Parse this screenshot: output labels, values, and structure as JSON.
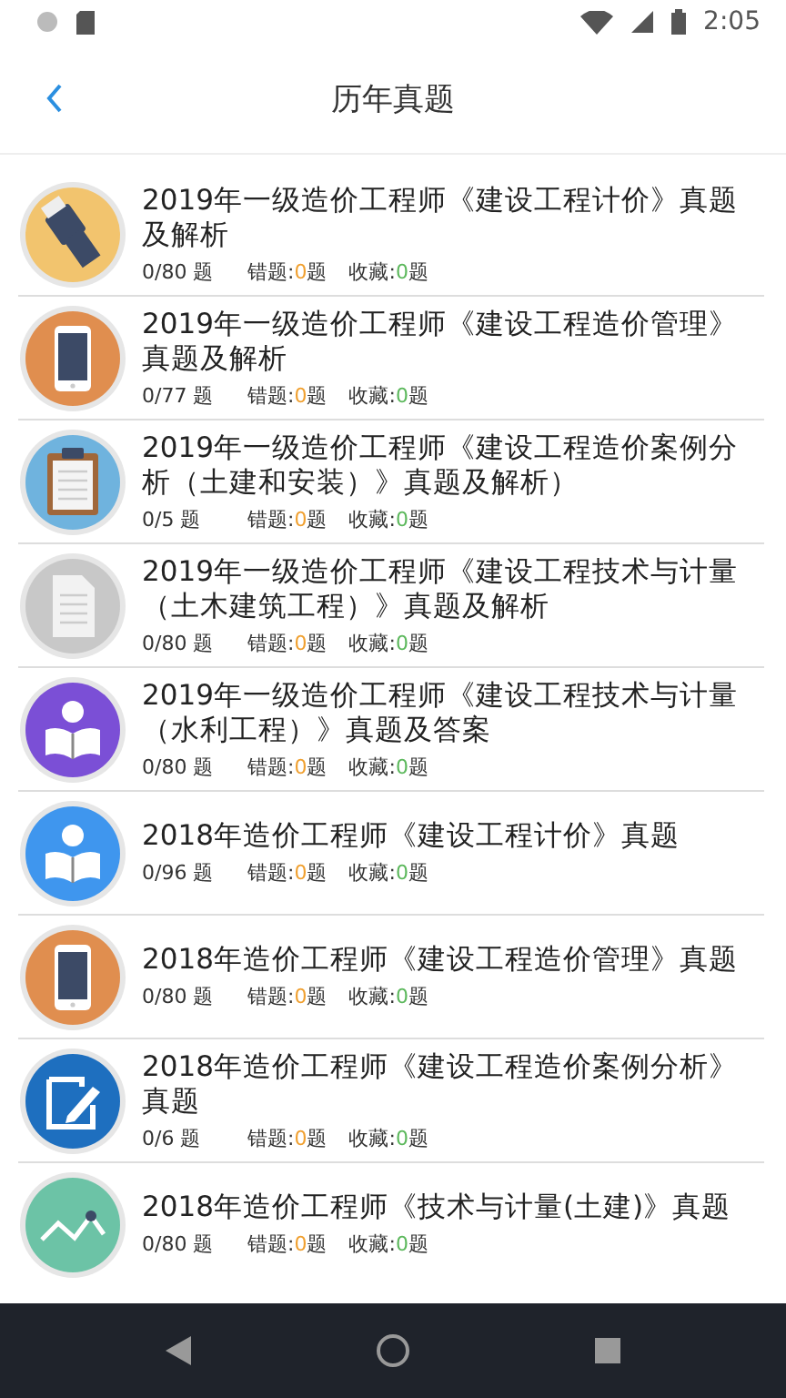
{
  "status_bar": {
    "time": "2:05"
  },
  "header": {
    "title": "历年真题"
  },
  "items": [
    {
      "title": "2019年一级造价工程师《建设工程计价》真题及解析",
      "kind": "hammer",
      "color": "#f2c46e",
      "progress": "0/80 题",
      "wrong": {
        "label": "错题:",
        "count": "0",
        "unit": "题"
      },
      "saved": {
        "label": "收藏:",
        "count": "0",
        "unit": "题"
      }
    },
    {
      "title": "2019年一级造价工程师《建设工程造价管理》真题及解析",
      "kind": "phone",
      "color": "#e08e4f",
      "progress": "0/77 题",
      "wrong": {
        "label": "错题:",
        "count": "0",
        "unit": "题"
      },
      "saved": {
        "label": "收藏:",
        "count": "0",
        "unit": "题"
      }
    },
    {
      "title": "2019年一级造价工程师《建设工程造价案例分析（土建和安装）》真题及解析）",
      "kind": "clipboard",
      "color": "#6fb3de",
      "progress": "0/5 题",
      "wrong": {
        "label": "错题:",
        "count": "0",
        "unit": "题"
      },
      "saved": {
        "label": "收藏:",
        "count": "0",
        "unit": "题"
      }
    },
    {
      "title": "2019年一级造价工程师《建设工程技术与计量（土木建筑工程）》真题及解析",
      "kind": "document",
      "color": "#c8c8c8",
      "progress": "0/80 题",
      "wrong": {
        "label": "错题:",
        "count": "0",
        "unit": "题"
      },
      "saved": {
        "label": "收藏:",
        "count": "0",
        "unit": "题"
      }
    },
    {
      "title": "2019年一级造价工程师《建设工程技术与计量（水利工程）》真题及答案",
      "kind": "reader",
      "color": "#7b4fd6",
      "progress": "0/80 题",
      "wrong": {
        "label": "错题:",
        "count": "0",
        "unit": "题"
      },
      "saved": {
        "label": "收藏:",
        "count": "0",
        "unit": "题"
      }
    },
    {
      "title": "2018年造价工程师《建设工程计价》真题",
      "kind": "reader",
      "color": "#3f96ee",
      "progress": "0/96 题",
      "wrong": {
        "label": "错题:",
        "count": "0",
        "unit": "题"
      },
      "saved": {
        "label": "收藏:",
        "count": "0",
        "unit": "题"
      }
    },
    {
      "title": "2018年造价工程师《建设工程造价管理》真题",
      "kind": "phone",
      "color": "#e08e4f",
      "progress": "0/80 题",
      "wrong": {
        "label": "错题:",
        "count": "0",
        "unit": "题"
      },
      "saved": {
        "label": "收藏:",
        "count": "0",
        "unit": "题"
      }
    },
    {
      "title": "2018年造价工程师《建设工程造价案例分析》真题",
      "kind": "edit",
      "color": "#1e6fbf",
      "progress": "0/6 题",
      "wrong": {
        "label": "错题:",
        "count": "0",
        "unit": "题"
      },
      "saved": {
        "label": "收藏:",
        "count": "0",
        "unit": "题"
      }
    },
    {
      "title": "2018年造价工程师《技术与计量(土建)》真题",
      "kind": "chart",
      "color": "#6cc3a6",
      "progress": "0/80 题",
      "wrong": {
        "label": "错题:",
        "count": "0",
        "unit": "题"
      },
      "saved": {
        "label": "收藏:",
        "count": "0",
        "unit": "题"
      }
    }
  ]
}
